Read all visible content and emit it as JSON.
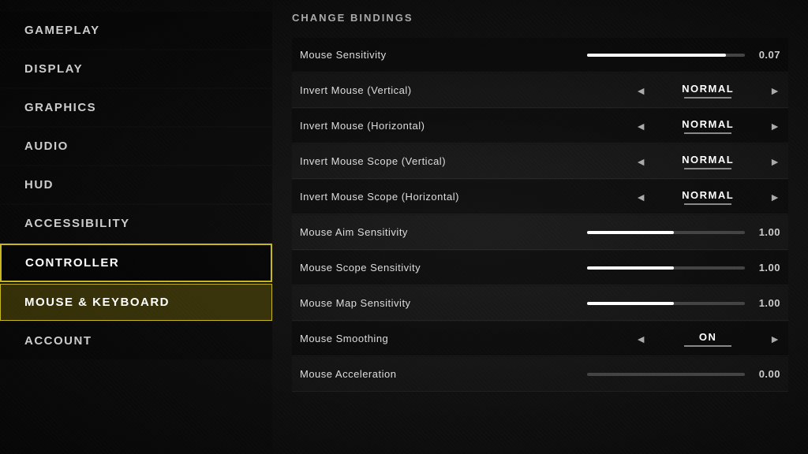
{
  "sidebar": {
    "items": [
      {
        "id": "gameplay",
        "label": "GAMEPLAY",
        "state": "normal"
      },
      {
        "id": "display",
        "label": "DISPLAY",
        "state": "normal"
      },
      {
        "id": "graphics",
        "label": "GRAPHICS",
        "state": "normal"
      },
      {
        "id": "audio",
        "label": "AUDIO",
        "state": "normal"
      },
      {
        "id": "hud",
        "label": "HUD",
        "state": "normal"
      },
      {
        "id": "accessibility",
        "label": "ACCESSIBILITY",
        "state": "normal"
      },
      {
        "id": "controller",
        "label": "CONTROLLER",
        "state": "active-outline"
      },
      {
        "id": "mouse-keyboard",
        "label": "MOUSE & KEYBOARD",
        "state": "active-fill"
      },
      {
        "id": "account",
        "label": "ACCOUNT",
        "state": "normal"
      }
    ]
  },
  "main": {
    "section_title": "CHANGE BINDINGS",
    "settings": [
      {
        "id": "mouse-sensitivity",
        "label": "Mouse Sensitivity",
        "type": "slider",
        "fill_pct": 88,
        "value": "0.07"
      },
      {
        "id": "invert-mouse-vertical",
        "label": "Invert Mouse (Vertical)",
        "type": "toggle",
        "value": "NORMAL"
      },
      {
        "id": "invert-mouse-horizontal",
        "label": "Invert Mouse (Horizontal)",
        "type": "toggle",
        "value": "NORMAL"
      },
      {
        "id": "invert-mouse-scope-vertical",
        "label": "Invert Mouse Scope (Vertical)",
        "type": "toggle",
        "value": "NORMAL"
      },
      {
        "id": "invert-mouse-scope-horizontal",
        "label": "Invert Mouse Scope (Horizontal)",
        "type": "toggle",
        "value": "NORMAL"
      },
      {
        "id": "mouse-aim-sensitivity",
        "label": "Mouse Aim Sensitivity",
        "type": "slider",
        "fill_pct": 55,
        "value": "1.00"
      },
      {
        "id": "mouse-scope-sensitivity",
        "label": "Mouse Scope Sensitivity",
        "type": "slider",
        "fill_pct": 55,
        "value": "1.00"
      },
      {
        "id": "mouse-map-sensitivity",
        "label": "Mouse Map Sensitivity",
        "type": "slider",
        "fill_pct": 55,
        "value": "1.00"
      },
      {
        "id": "mouse-smoothing",
        "label": "Mouse Smoothing",
        "type": "toggle",
        "value": "ON"
      },
      {
        "id": "mouse-acceleration",
        "label": "Mouse Acceleration",
        "type": "slider",
        "fill_pct": 0,
        "value": "0.00"
      }
    ]
  },
  "icons": {
    "arrow_left": "◄",
    "arrow_right": "►"
  }
}
